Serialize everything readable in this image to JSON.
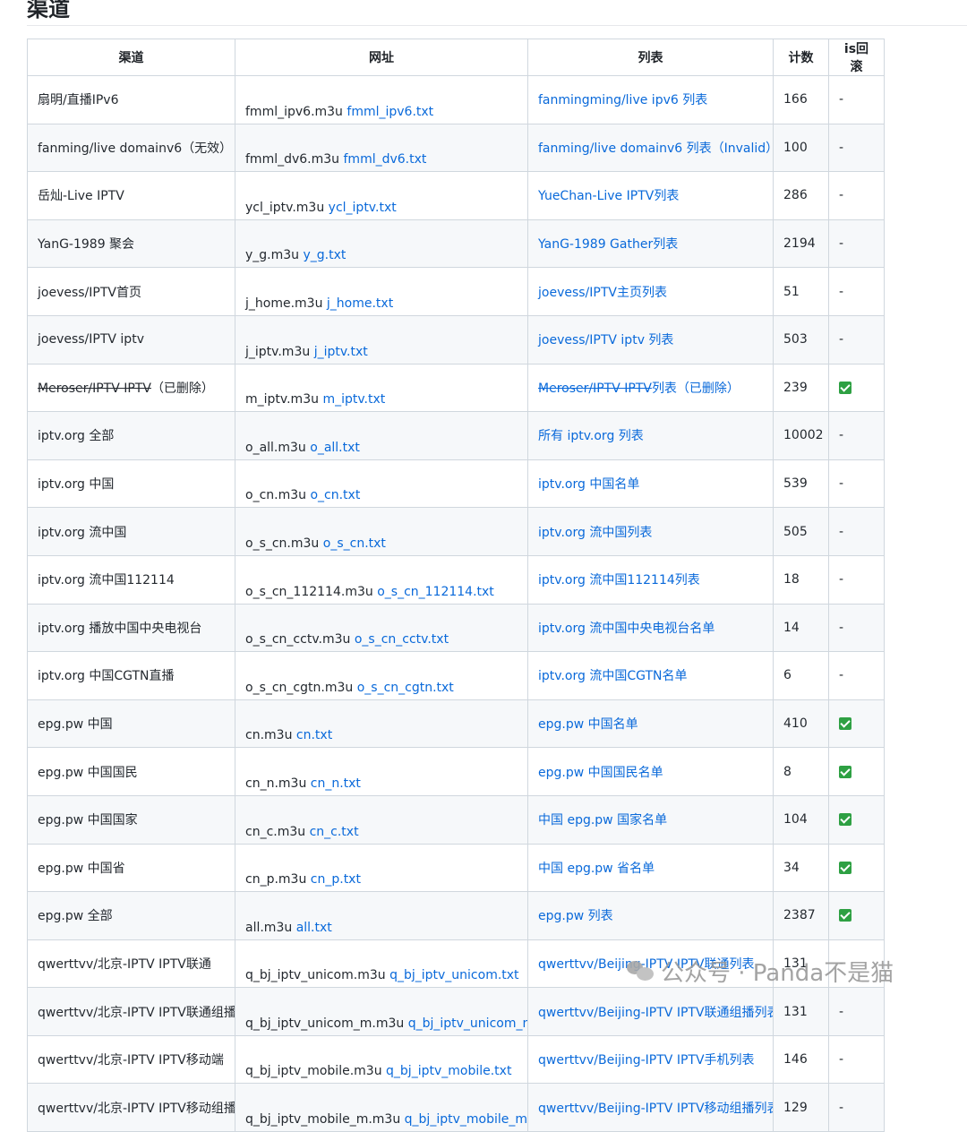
{
  "heading": "渠道",
  "table": {
    "headers": [
      "渠道",
      "网址",
      "列表",
      "计数",
      "is回滚"
    ],
    "rows": [
      {
        "channel": "扇明/直播IPv6",
        "m3u": "fmml_ipv6.m3u",
        "txt": "fmml_ipv6.txt",
        "list": "fanmingming/live ipv6 列表",
        "count": "166",
        "rollback": "-"
      },
      {
        "channel": "fanming/live domainv6（无效）",
        "m3u": "fmml_dv6.m3u",
        "txt": "fmml_dv6.txt",
        "list": "fanming/live domainv6 列表（Invalid）",
        "count": "100",
        "rollback": "-"
      },
      {
        "channel": "岳灿-Live IPTV",
        "m3u": "ycl_iptv.m3u",
        "txt": "ycl_iptv.txt",
        "list": "YueChan-Live IPTV列表",
        "count": "286",
        "rollback": "-"
      },
      {
        "channel": "YanG-1989 聚会",
        "m3u": "y_g.m3u",
        "txt": "y_g.txt",
        "list": "YanG-1989 Gather列表",
        "count": "2194",
        "rollback": "-"
      },
      {
        "channel": "joevess/IPTV首页",
        "m3u": "j_home.m3u",
        "txt": "j_home.txt",
        "list": "joevess/IPTV主页列表",
        "count": "51",
        "rollback": "-"
      },
      {
        "channel": "joevess/IPTV iptv",
        "m3u": "j_iptv.m3u",
        "txt": "j_iptv.txt",
        "list": "joevess/IPTV iptv 列表",
        "count": "503",
        "rollback": "-"
      },
      {
        "channel_strike": "Meroser/IPTV IPTV",
        "channel": "（已删除）",
        "m3u": "m_iptv.m3u",
        "txt": "m_iptv.txt",
        "list_strike": "Meroser/IPTV IPTV",
        "list": "列表（已删除）",
        "count": "239",
        "rollback": "check"
      },
      {
        "channel": "iptv.org 全部",
        "m3u": "o_all.m3u",
        "txt": "o_all.txt",
        "list": "所有 iptv.org 列表",
        "count": "10002",
        "rollback": "-"
      },
      {
        "channel": "iptv.org 中国",
        "m3u": "o_cn.m3u",
        "txt": "o_cn.txt",
        "list": "iptv.org 中国名单",
        "count": "539",
        "rollback": "-"
      },
      {
        "channel": "iptv.org 流中国",
        "m3u": "o_s_cn.m3u",
        "txt": "o_s_cn.txt",
        "list": "iptv.org 流中国列表",
        "count": "505",
        "rollback": "-"
      },
      {
        "channel": "iptv.org 流中国112114",
        "m3u": "o_s_cn_112114.m3u",
        "txt": "o_s_cn_112114.txt",
        "list": "iptv.org 流中国112114列表",
        "count": "18",
        "rollback": "-"
      },
      {
        "channel": "iptv.org 播放中国中央电视台",
        "m3u": "o_s_cn_cctv.m3u",
        "txt": "o_s_cn_cctv.txt",
        "list": "iptv.org 流中国中央电视台名单",
        "count": "14",
        "rollback": "-"
      },
      {
        "channel": "iptv.org 中国CGTN直播",
        "m3u": "o_s_cn_cgtn.m3u",
        "txt": "o_s_cn_cgtn.txt",
        "list": "iptv.org 流中国CGTN名单",
        "count": "6",
        "rollback": "-"
      },
      {
        "channel": "epg.pw 中国",
        "m3u": "cn.m3u",
        "txt": "cn.txt",
        "list": "epg.pw 中国名单",
        "count": "410",
        "rollback": "check"
      },
      {
        "channel": "epg.pw 中国国民",
        "m3u": "cn_n.m3u",
        "txt": "cn_n.txt",
        "list": "epg.pw 中国国民名单",
        "count": "8",
        "rollback": "check"
      },
      {
        "channel": "epg.pw 中国国家",
        "m3u": "cn_c.m3u",
        "txt": "cn_c.txt",
        "list": "中国 epg.pw 国家名单",
        "count": "104",
        "rollback": "check"
      },
      {
        "channel": "epg.pw 中国省",
        "m3u": "cn_p.m3u",
        "txt": "cn_p.txt",
        "list": "中国 epg.pw 省名单",
        "count": "34",
        "rollback": "check"
      },
      {
        "channel": "epg.pw 全部",
        "m3u": "all.m3u",
        "txt": "all.txt",
        "list": "epg.pw 列表",
        "count": "2387",
        "rollback": "check"
      },
      {
        "channel": "qwerttvv/北京-IPTV IPTV联通",
        "m3u": "q_bj_iptv_unicom.m3u",
        "txt": "q_bj_iptv_unicom.txt",
        "list": "qwerttvv/Beijing-IPTV IPTV联通列表",
        "count": "131",
        "rollback": "-"
      },
      {
        "channel": "qwerttvv/北京-IPTV IPTV联通组播",
        "m3u": "q_bj_iptv_unicom_m.m3u",
        "txt": "q_bj_iptv_unicom_m.txt",
        "list": "qwerttvv/Beijing-IPTV IPTV联通组播列表",
        "count": "131",
        "rollback": "-"
      },
      {
        "channel": "qwerttvv/北京-IPTV IPTV移动端",
        "m3u": "q_bj_iptv_mobile.m3u",
        "txt": "q_bj_iptv_mobile.txt",
        "list": "qwerttvv/Beijing-IPTV IPTV手机列表",
        "count": "146",
        "rollback": "-"
      },
      {
        "channel": "qwerttvv/北京-IPTV IPTV移动组播",
        "m3u": "q_bj_iptv_mobile_m.m3u",
        "txt": "q_bj_iptv_mobile_m.txt",
        "list": "qwerttvv/Beijing-IPTV IPTV移动组播列表",
        "count": "129",
        "rollback": "-"
      }
    ]
  },
  "watermark": "公众号 · Panda不是猫",
  "colors": {
    "link": "#0969da",
    "check": "#2ea043",
    "border": "#d0d7de",
    "stripe": "#f6f8fa"
  }
}
